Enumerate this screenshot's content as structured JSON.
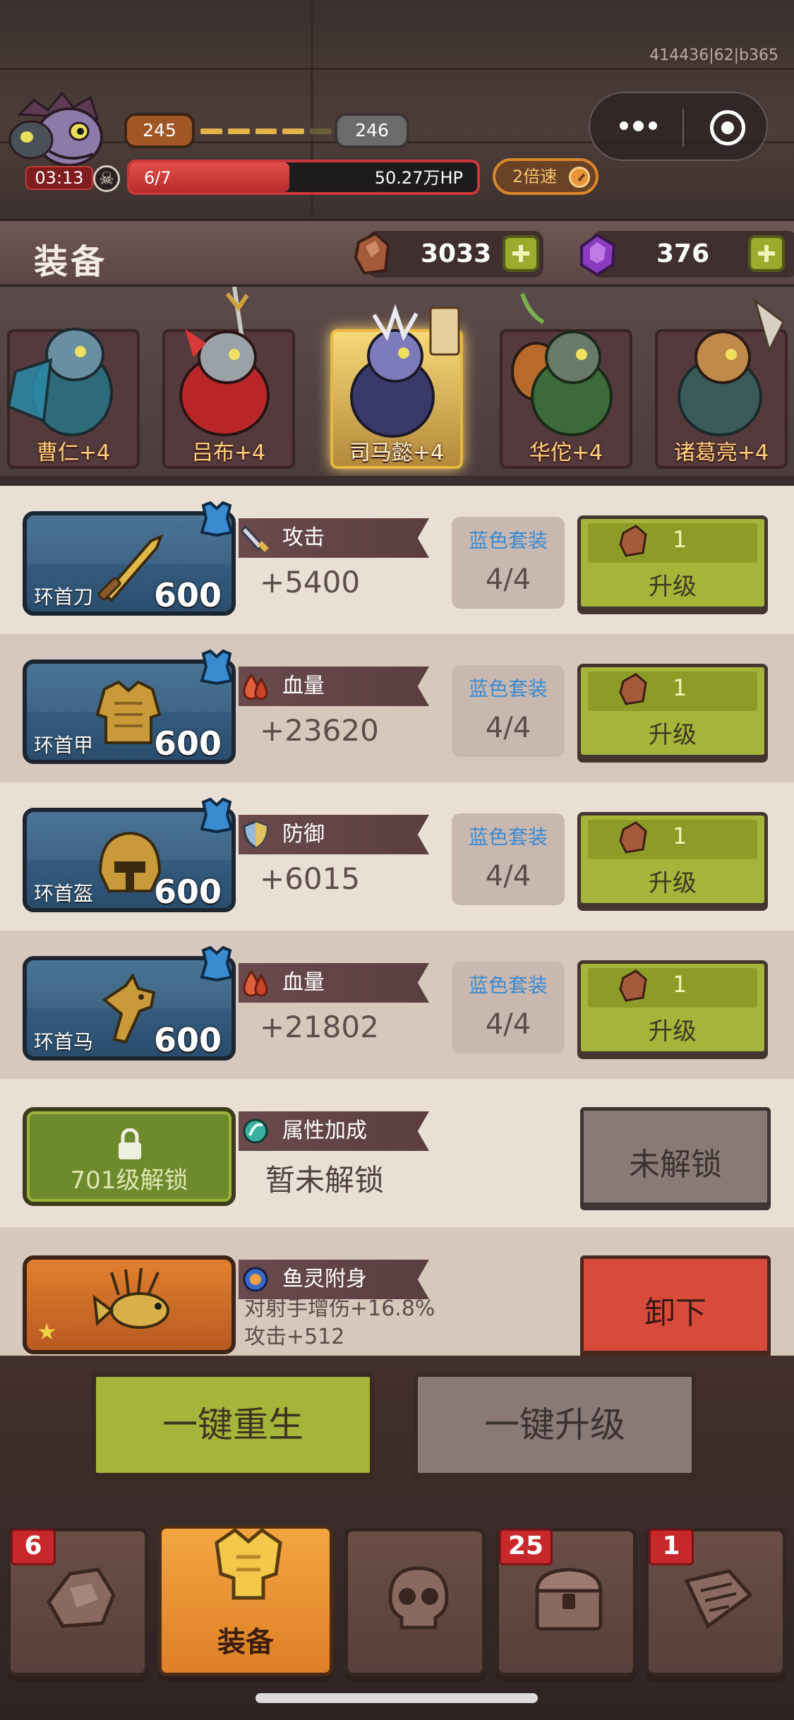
{
  "status": {
    "build_id": "414436|62|b365"
  },
  "boss": {
    "timer": "03:13",
    "level_current": "245",
    "level_next": "246",
    "level_progress_dots": 5,
    "level_progress_lit": 4,
    "hp_count": "6/7",
    "hp_total": "50.27万HP",
    "hp_fill_fraction": 0.46
  },
  "speed": {
    "label": "2倍速"
  },
  "header": {
    "title": "装备",
    "copper": {
      "value": "3033",
      "icon": "copper-ore-icon"
    },
    "purple": {
      "value": "376",
      "icon": "purple-gem-icon"
    }
  },
  "heroes": [
    {
      "name": "曹仁+4",
      "selected": false
    },
    {
      "name": "吕布+4",
      "selected": false
    },
    {
      "name": "司马懿+4",
      "selected": true
    },
    {
      "name": "华佗+4",
      "selected": false
    },
    {
      "name": "诸葛亮+4",
      "selected": false
    }
  ],
  "equipment": [
    {
      "name": "环首刀",
      "level": "600",
      "stat_label": "攻击",
      "stat_icon": "sword-icon",
      "stat_value": "+5400",
      "set_name": "蓝色套装",
      "set_count": "4/4",
      "upgrade_cost": "1",
      "upgrade_label": "升级"
    },
    {
      "name": "环首甲",
      "level": "600",
      "stat_label": "血量",
      "stat_icon": "blood-icon",
      "stat_value": "+23620",
      "set_name": "蓝色套装",
      "set_count": "4/4",
      "upgrade_cost": "1",
      "upgrade_label": "升级"
    },
    {
      "name": "环首盔",
      "level": "600",
      "stat_label": "防御",
      "stat_icon": "shield-icon",
      "stat_value": "+6015",
      "set_name": "蓝色套装",
      "set_count": "4/4",
      "upgrade_cost": "1",
      "upgrade_label": "升级"
    },
    {
      "name": "环首马",
      "level": "600",
      "stat_label": "血量",
      "stat_icon": "blood-icon",
      "stat_value": "+21802",
      "set_name": "蓝色套装",
      "set_count": "4/4",
      "upgrade_cost": "1",
      "upgrade_label": "升级"
    }
  ],
  "attribute_slot": {
    "lock_text": "701级解锁",
    "stat_label": "属性加成",
    "value": "暂未解锁",
    "button_label": "未解锁"
  },
  "pet_slot": {
    "stat_label": "鱼灵附身",
    "line1": "对射手增伤+16.8%",
    "line2": "攻击+512",
    "button_label": "卸下"
  },
  "actions": {
    "rebirth": "一键重生",
    "upgrade_all": "一键升级"
  },
  "nav": [
    {
      "id": "ore",
      "label": "",
      "badge": "6",
      "icon": "ore-icon"
    },
    {
      "id": "equip",
      "label": "装备",
      "badge": "",
      "icon": "golden-armor-icon",
      "active": true
    },
    {
      "id": "skull",
      "label": "",
      "badge": "",
      "icon": "skull-icon"
    },
    {
      "id": "chest",
      "label": "",
      "badge": "25",
      "icon": "treasure-chest-icon"
    },
    {
      "id": "scroll",
      "label": "",
      "badge": "1",
      "icon": "map-scroll-icon"
    }
  ],
  "colors": {
    "accent_green": "#a7b43a",
    "danger_red": "#d84a3a",
    "set_blue": "#3c8ad0",
    "nav_active": "#e8902f"
  }
}
